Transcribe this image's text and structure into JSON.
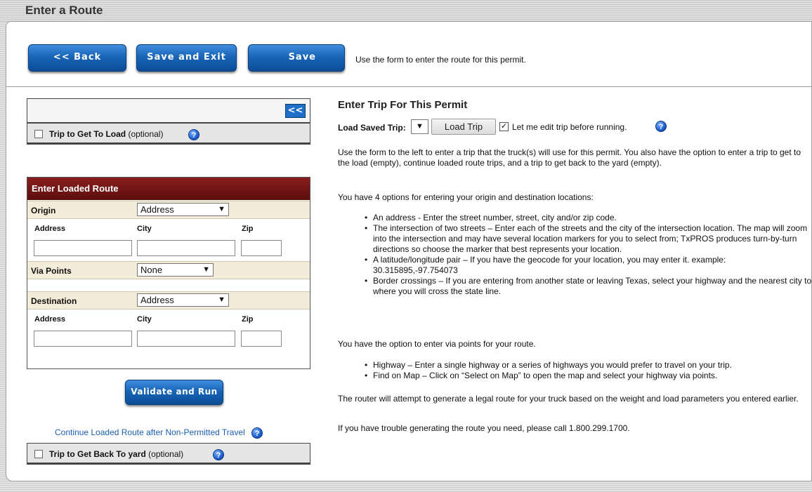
{
  "page": {
    "title": "Enter a Route"
  },
  "toolbar": {
    "back_label": "<< Back",
    "save_exit_label": "Save and Exit",
    "save_label": "Save",
    "hint": "Use the form to enter the route for this permit."
  },
  "left": {
    "collapse_label": "<<",
    "trip_to_load": {
      "bold": "Trip to Get To Load",
      "rest": " (optional)"
    },
    "loaded_route": {
      "heading": "Enter Loaded Route",
      "origin": {
        "label": "Origin",
        "type_value": "Address"
      },
      "address_label": "Address",
      "city_label": "City",
      "zip_label": "Zip",
      "via": {
        "label": "Via Points",
        "value": "None"
      },
      "destination": {
        "label": "Destination",
        "type_value": "Address"
      }
    },
    "validate_label": "Validate and Run",
    "continue_link": "Continue Loaded Route after Non-Permitted Travel",
    "trip_back": {
      "bold": "Trip to Get Back To yard",
      "rest": " (optional)"
    },
    "help_glyph": "?"
  },
  "right": {
    "heading": "Enter Trip For This Permit",
    "load_saved_label": "Load Saved Trip:",
    "load_trip_button": "Load Trip",
    "edit_checkbox_label": "Let me edit trip before running.",
    "edit_checked": true,
    "intro": "Use the form to the left to enter a trip that the truck(s) will use for this permit. You also have the option to enter a trip to get to the load (empty), continue loaded route trips, and a trip to get back to the yard (empty).",
    "options_intro": "You have 4 options for entering your origin and destination locations:",
    "options": [
      "An address - Enter the street number, street, city and/or zip code.",
      "The intersection of two streets – Enter each of the streets and the city of the intersection location. The map will zoom into the intersection and may have several location markers for you to select from; TxPROS produces turn-by-turn directions so choose the marker that best represents your location.",
      "A latitude/longitude pair – If you have the geocode for your location, you may enter it. example: 30.315895,-97.754073",
      "Border crossings – If you are entering from another state or leaving Texas, select your highway and the nearest city to where you will cross the state line."
    ],
    "via_intro": "You have the option to enter via points for your route.",
    "via_options": [
      "Highway – Enter a single highway or a series of highways you would prefer to travel on your trip.",
      "Find on Map – Click on “Select on Map” to open the map and select your highway via points."
    ],
    "router_note": "The router will attempt to generate a legal route for your truck based on the weight and load parameters you entered earlier.",
    "trouble_note": "If you have trouble generating the route you need, please call 1.800.299.1700."
  }
}
